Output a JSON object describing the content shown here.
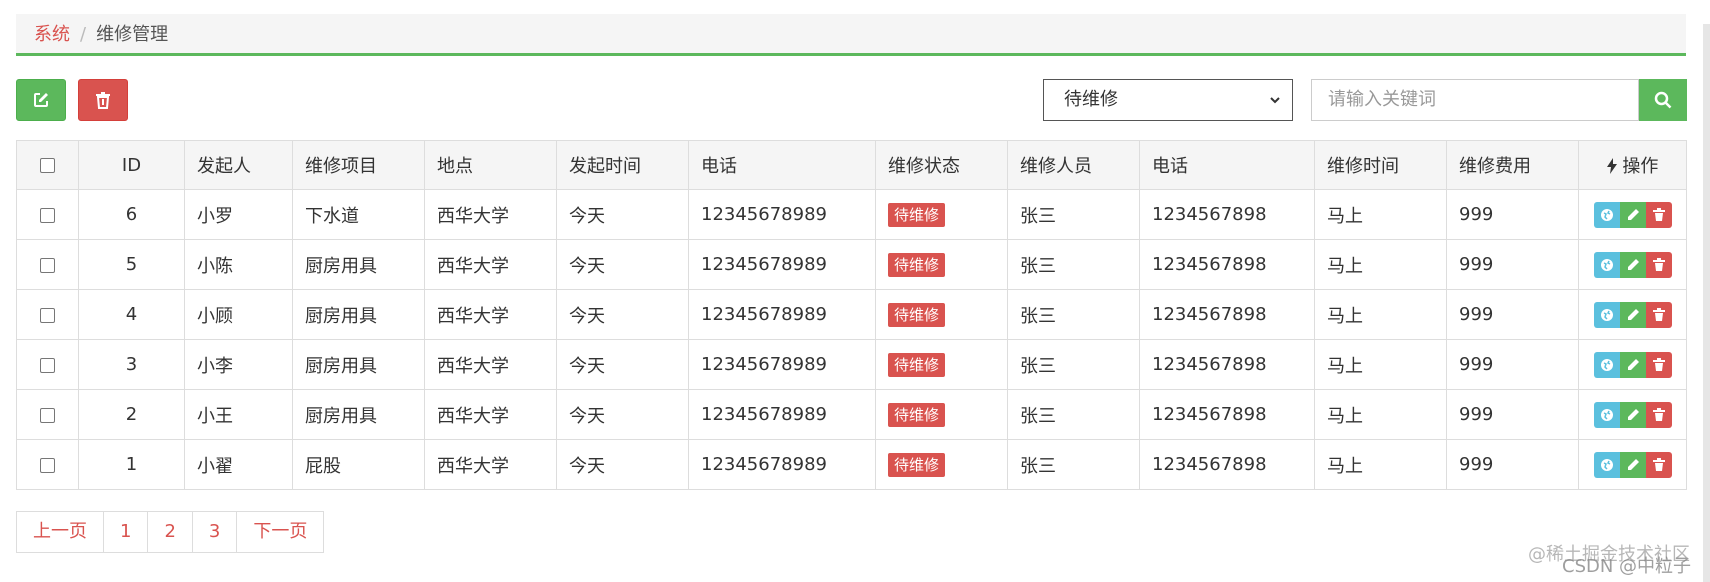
{
  "breadcrumb": {
    "root": "系统",
    "separator": "/",
    "current": "维修管理"
  },
  "toolbar": {
    "add_icon": "edit-icon",
    "delete_icon": "trash-icon"
  },
  "filter": {
    "status_selected": "待维修",
    "search_placeholder": "请输入关键词",
    "search_icon": "search-icon"
  },
  "table": {
    "headers": {
      "id": "ID",
      "initiator": "发起人",
      "item": "维修项目",
      "location": "地点",
      "time": "发起时间",
      "phone": "电话",
      "status": "维修状态",
      "worker": "维修人员",
      "worker_phone": "电话",
      "repair_time": "维修时间",
      "cost": "维修费用",
      "actions": "操作"
    },
    "rows": [
      {
        "id": "6",
        "initiator": "小罗",
        "item": "下水道",
        "location": "西华大学",
        "time": "今天",
        "phone": "12345678989",
        "status": "待维修",
        "worker": "张三",
        "worker_phone": "1234567898",
        "repair_time": "马上",
        "cost": "999"
      },
      {
        "id": "5",
        "initiator": "小陈",
        "item": "厨房用具",
        "location": "西华大学",
        "time": "今天",
        "phone": "12345678989",
        "status": "待维修",
        "worker": "张三",
        "worker_phone": "1234567898",
        "repair_time": "马上",
        "cost": "999"
      },
      {
        "id": "4",
        "initiator": "小顾",
        "item": "厨房用具",
        "location": "西华大学",
        "time": "今天",
        "phone": "12345678989",
        "status": "待维修",
        "worker": "张三",
        "worker_phone": "1234567898",
        "repair_time": "马上",
        "cost": "999"
      },
      {
        "id": "3",
        "initiator": "小李",
        "item": "厨房用具",
        "location": "西华大学",
        "time": "今天",
        "phone": "12345678989",
        "status": "待维修",
        "worker": "张三",
        "worker_phone": "1234567898",
        "repair_time": "马上",
        "cost": "999"
      },
      {
        "id": "2",
        "initiator": "小王",
        "item": "厨房用具",
        "location": "西华大学",
        "time": "今天",
        "phone": "12345678989",
        "status": "待维修",
        "worker": "张三",
        "worker_phone": "1234567898",
        "repair_time": "马上",
        "cost": "999"
      },
      {
        "id": "1",
        "initiator": "小翟",
        "item": "屁股",
        "location": "西华大学",
        "time": "今天",
        "phone": "12345678989",
        "status": "待维修",
        "worker": "张三",
        "worker_phone": "1234567898",
        "repair_time": "马上",
        "cost": "999"
      }
    ]
  },
  "pagination": {
    "prev": "上一页",
    "pages": [
      "1",
      "2",
      "3"
    ],
    "next": "下一页"
  },
  "watermark": {
    "line1": "@稀土掘金技术社区",
    "line2": "CSDN @中粒子"
  },
  "colors": {
    "accent_green": "#5cb85c",
    "danger_red": "#d9534f",
    "info_blue": "#5bc0de"
  }
}
